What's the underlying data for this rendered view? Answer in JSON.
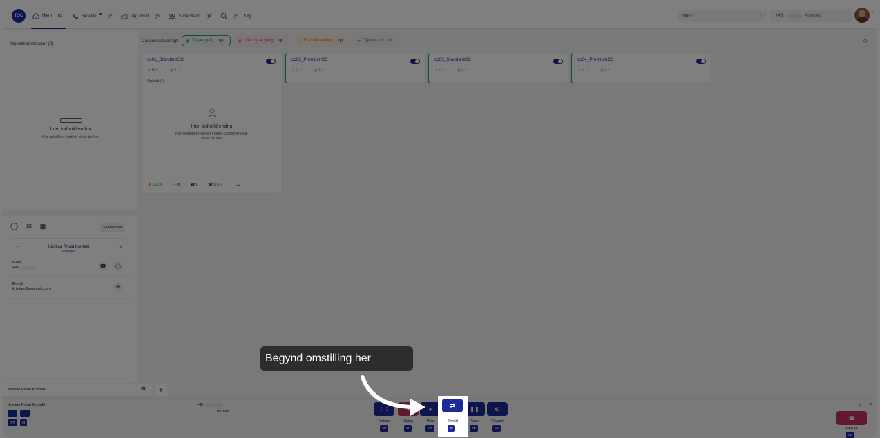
{
  "topbar": {
    "logo": "TOC",
    "nav": [
      {
        "label": "Hjem",
        "key": "g1",
        "icon": "home-icon"
      },
      {
        "label": "Seneste",
        "key": "g2",
        "icon": "phone-icon"
      },
      {
        "label": "Tag cloud",
        "key": "g3",
        "icon": "tag-icon"
      },
      {
        "label": "Supervision",
        "key": "g4",
        "icon": "supervision-icon"
      },
      {
        "label": "Søg",
        "key": "g5",
        "icon": "search-icon"
      }
    ],
    "status_select": "Ingen",
    "phone_prefix": "+45",
    "profile_select": "Arbejde)"
  },
  "distributor": {
    "title": "Opkaldsdistributør (0)",
    "empty_title": "Intet indhold endnu",
    "empty_desc": "Når opkald er fordelt, vises de her."
  },
  "callcenters": {
    "header": "Callcenteroversigt",
    "filters": [
      {
        "label": "Tilgængelig",
        "key": "qa",
        "color": "#1aa082"
      },
      {
        "label": "Ikke tilgængelig",
        "key": "qu",
        "color": "#d9466a"
      },
      {
        "label": "Efterbehandling",
        "key": "qw",
        "color": "#e8773a"
      },
      {
        "label": "Tjekket ud",
        "key": "ql",
        "color": "#555555"
      }
    ],
    "cards": [
      {
        "name": "cc01_StandardCC",
        "agents": "0",
        "queue": "2",
        "calls_label": "Opkald (0)"
      },
      {
        "name": "cc02_PremiumCC",
        "agents": "0",
        "queue": "1"
      },
      {
        "name": "cc03_StandardCC",
        "agents": "0",
        "queue": "0"
      },
      {
        "name": "cc04_PremiumCC",
        "agents": "0",
        "queue": "0"
      }
    ],
    "expanded": {
      "empty_title": "Intet indhold endnu",
      "empty_desc": "Når opkaldere venter i dette callcenters kø, vises de her.",
      "stats": [
        "100%",
        "0s",
        "0",
        "0"
      ],
      "stat_extra": "(0)"
    }
  },
  "contact": {
    "templates_label": "Skabeloner",
    "name": "Kristian Privat Kontakt",
    "edit_label": "Rediger",
    "mobile_label": "Mobil",
    "mobile_value": "+45",
    "email_label": "E-mail",
    "email_value": "kristian@example.com",
    "tab_label": "Kristian Privat Kontakt"
  },
  "call": {
    "contact_name": "Kristian Privat Kontakt",
    "number": "+45",
    "duration": "1m 18s",
    "left_keys": [
      "om",
      "ot"
    ],
    "controls": [
      {
        "label": "Tastatur",
        "key": "cd",
        "icon": "keypad-icon"
      },
      {
        "label": "Optag",
        "key": "cr",
        "icon": "record-icon"
      },
      {
        "label": "Mute",
        "key": "cm",
        "icon": "mic-icon"
      },
      {
        "label": "Omstil",
        "key": "ct",
        "icon": "transfer-icon"
      },
      {
        "label": "Pause",
        "key": "ch",
        "icon": "pause-icon"
      },
      {
        "label": "Flerpart",
        "key": "cp",
        "icon": "conference-icon"
      }
    ],
    "hangup_label": "Læg på",
    "hangup_key": "ce"
  },
  "tooltip": "Begynd omstilling her"
}
